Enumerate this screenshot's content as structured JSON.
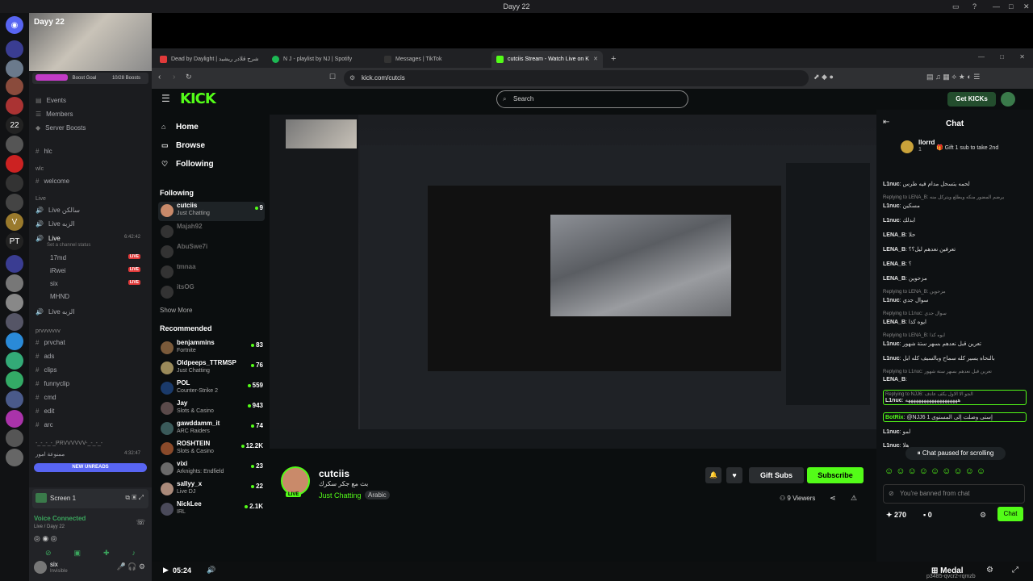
{
  "window": {
    "title": "Dayy 22"
  },
  "discord": {
    "server_name": "Dayy 22",
    "boost_label": "Boost Goal",
    "boost_count": "10/28 Boosts",
    "boost_progress": 0.36,
    "menu": [
      "Events",
      "Members",
      "Server Boosts"
    ],
    "channels": [
      {
        "name": "hlc"
      },
      {
        "category": "wlc"
      },
      {
        "name": "welcome"
      },
      {
        "category": "Live"
      },
      {
        "name": "Live سالكن"
      },
      {
        "name": "Live الزبه"
      },
      {
        "name": "Live",
        "status": "Set a channel status",
        "time": "6:42:42"
      },
      {
        "member": "17md",
        "badge": "LIVE"
      },
      {
        "member": "iRwei",
        "badge": "LIVE"
      },
      {
        "member": "six",
        "badge": "LIVE"
      },
      {
        "member": "MHND"
      },
      {
        "name": "Live الزبه"
      },
      {
        "category": "prvvvvvvv"
      },
      {
        "name": "prvchat"
      },
      {
        "name": "ads"
      },
      {
        "name": "clips"
      },
      {
        "name": "funnyclip"
      },
      {
        "name": "cmd"
      },
      {
        "name": "edit"
      },
      {
        "name": "arc"
      },
      {
        "category": "-_-_-_-_PRVVVVVV-_-_-_-"
      },
      {
        "name": "ممنوعة امور",
        "time": "4:32:47"
      }
    ],
    "new_unreads": "NEW UNREADS",
    "screen_label": "Screen 1",
    "voice_connected": "Voice Connected",
    "voice_channel": "Live / Dayy 22",
    "user_name": "six",
    "user_status": "Invisible"
  },
  "browser": {
    "tabs": [
      {
        "label": "Dead by Daylight | شرح قلادر ريشيد",
        "color": "#e13a3a"
      },
      {
        "label": "N J - playlist by NJ | Spotify",
        "color": "#1db954"
      },
      {
        "label": "Messages | TikTok",
        "color": "#111111"
      },
      {
        "label": "cutciis Stream - Watch Live on K",
        "color": "#53fc18",
        "active": true
      }
    ],
    "url": "kick.com/cutcis"
  },
  "kick": {
    "logo": "KICK",
    "search_placeholder": "Search",
    "get_kicks": "Get KICKs",
    "nav": [
      {
        "label": "Home",
        "icon": "home-icon"
      },
      {
        "label": "Browse",
        "icon": "browse-icon"
      },
      {
        "label": "Following",
        "icon": "heart-icon"
      }
    ],
    "following_title": "Following",
    "following": [
      {
        "name": "cutciis",
        "sub": "Just Chatting",
        "viewers": "9",
        "online": true
      },
      {
        "name": "Majah92",
        "online": false
      },
      {
        "name": "AbuSwe7i",
        "online": false
      },
      {
        "name": "tmnaa",
        "online": false
      },
      {
        "name": "itsOG",
        "online": false
      }
    ],
    "show_more": "Show More",
    "recommended_title": "Recommended",
    "recommended": [
      {
        "name": "benjammins",
        "sub": "Fortnite",
        "viewers": "83"
      },
      {
        "name": "Oldpeeps_TTRMSP",
        "sub": "Just Chatting",
        "viewers": "76"
      },
      {
        "name": "POL",
        "sub": "Counter-Strike 2",
        "viewers": "559"
      },
      {
        "name": "Jay",
        "sub": "Slots & Casino",
        "viewers": "943"
      },
      {
        "name": "gawddamm_it",
        "sub": "ARC Raiders",
        "viewers": "74"
      },
      {
        "name": "ROSHTEIN",
        "sub": "Slots & Casino",
        "viewers": "12.2K"
      },
      {
        "name": "vixi",
        "sub": "Arknights: Endfield",
        "viewers": "23"
      },
      {
        "name": "sallyy_x",
        "sub": "Live DJ",
        "viewers": "22"
      },
      {
        "name": "NickLee",
        "sub": "IRL",
        "viewers": "2.1K"
      }
    ],
    "streamer": {
      "name": "cutciis",
      "title": "بث مع جكر سكرك",
      "category": "Just Chatting",
      "tag": "Arabic",
      "live_badge": "LIVE",
      "viewers": "9 Viewers",
      "gift_subs": "Gift Subs",
      "subscribe": "Subscribe"
    },
    "player": {
      "time": "05:24",
      "brand": "Medal",
      "watermark": "p3485-qvcr2-rqmzb"
    },
    "chat": {
      "title": "Chat",
      "pinned_user": "llorrd",
      "pinned_count": "1",
      "pinned_text": "Gift 1 sub to take 2nd",
      "messages": [
        {
          "user": "L1nuc",
          "text": "لحمه يتسحل مدام فيه طرس"
        },
        {
          "reply": "Replying to LENA_B: يرضم المضور منكه ويطلع ويتركل منه"
        },
        {
          "user": "L1nuc",
          "text": "مسكين"
        },
        {
          "user": "L1nuc",
          "text": "ابدلك"
        },
        {
          "user": "LENA_B",
          "text": "حلا"
        },
        {
          "user": "LENA_B",
          "text": "تعرفين نعدهم ليل؟؟"
        },
        {
          "user": "LENA_B",
          "text": "؟"
        },
        {
          "user": "LENA_B",
          "text": "مزحوين"
        },
        {
          "reply": "Replying to LENA_B: مزحوين"
        },
        {
          "user": "L1nuc",
          "text": "سوال جدي"
        },
        {
          "reply": "Replying to L1nuc: سوال جدي"
        },
        {
          "user": "LENA_B",
          "text": "ايوه كذا"
        },
        {
          "reply": "Replying to LENA_B: ايوه كذا"
        },
        {
          "user": "L1nuc",
          "text": "تعرين قبل نعدهم بسهر ستة شهور"
        },
        {
          "user": "L1nuc",
          "text": "بالنحاه يسير كله سماح وبالسيف كله ابل"
        },
        {
          "reply": "Replying to L1nuc: تعرين قبل نعدهم بسهر ستة شهور"
        },
        {
          "user": "LENA_B",
          "text": ""
        },
        {
          "reply": "Replying to NJJ6: الجو الا الاول يكف عادف"
        },
        {
          "user": "L1nuc",
          "text": "ههههههههههههههههههههه"
        },
        {
          "user": "BotRix",
          "text": "@NJJ6 إستى وصلت إلى المستوى 1"
        },
        {
          "user": "L1nuc",
          "text": "لمو"
        },
        {
          "user": "L1nuc",
          "text": "هلا"
        }
      ],
      "paused": "Chat paused for scrolling",
      "banned_placeholder": "You're banned from chat",
      "points": "270",
      "kicks": "0",
      "send": "Chat"
    }
  }
}
